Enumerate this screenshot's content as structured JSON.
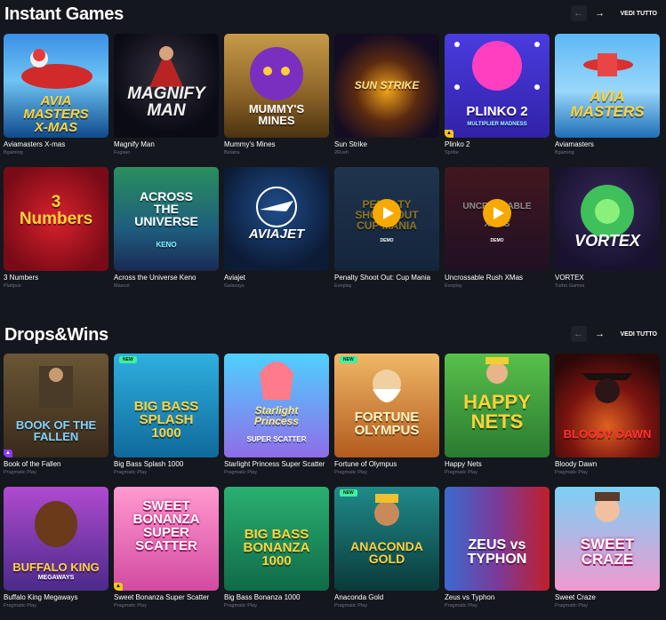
{
  "sections": [
    {
      "title": "Instant Games",
      "see_all": "VEDI TUTTO",
      "games": [
        {
          "name": "Aviamasters X-mas",
          "provider": "Bgaming",
          "art": "AVIA\nMASTERS\nX-MAS"
        },
        {
          "name": "Magnify Man",
          "provider": "Fugaso",
          "art": "MAGNIFY\nMAN"
        },
        {
          "name": "Mummy's Mines",
          "provider": "Belatra",
          "art": "MUMMY'S\nMINES"
        },
        {
          "name": "Sun Strike",
          "provider": "2Rush",
          "art": "SUN STRIKE"
        },
        {
          "name": "Plinko 2",
          "provider": "Spribe",
          "art": "PLINKO 2",
          "art_sub": "MULTIPLIER MADNESS"
        },
        {
          "name": "Aviamasters",
          "provider": "Bgaming",
          "art": "AVIA\nMASTERS"
        },
        {
          "name": "3 Numbers",
          "provider": "Platipus",
          "art": "3\nNumbers"
        },
        {
          "name": "Across the Universe Keno",
          "provider": "Mascot",
          "art": "ACROSS\nTHE\nUNIVERSE",
          "art_sub": "KENO"
        },
        {
          "name": "Aviajet",
          "provider": "Galaxsys",
          "art": "AVIAJET"
        },
        {
          "name": "Penalty Shoot Out: Cup Mania",
          "provider": "Evoplay",
          "art": "PENALTY\nSHOOT OUT\nCUP MANIA",
          "demo": "DEMO"
        },
        {
          "name": "Uncrossable Rush XMas",
          "provider": "Evoplay",
          "art": "UNCROSSABLE\nRUSH\nXMAS",
          "demo": "DEMO"
        },
        {
          "name": "VORTEX",
          "provider": "Turbo Games",
          "art": "VORTEX"
        }
      ]
    },
    {
      "title": "Drops&Wins",
      "see_all": "VEDI TUTTO",
      "games": [
        {
          "name": "Book of the Fallen",
          "provider": "Pragmatic Play",
          "art": "BOOK OF THE\nFALLEN"
        },
        {
          "name": "Big Bass Splash 1000",
          "provider": "Pragmatic Play",
          "art": "BIG BASS\nSPLASH\n1000",
          "badge": "NEW"
        },
        {
          "name": "Starlight Princess Super Scatter",
          "provider": "Pragmatic Play",
          "art": "Starlight\nPrincess",
          "art_sub": "SUPER SCATTER"
        },
        {
          "name": "Fortune of Olympus",
          "provider": "Pragmatic Play",
          "art": "FORTUNE\nOLYMPUS",
          "badge": "NEW"
        },
        {
          "name": "Happy Nets",
          "provider": "Pragmatic Play",
          "art": "HAPPY\nNETS"
        },
        {
          "name": "Bloody Dawn",
          "provider": "Pragmatic Play",
          "art": "BLOODY DAWN"
        },
        {
          "name": "Buffalo King Megaways",
          "provider": "Pragmatic Play",
          "art": "BUFFALO KING",
          "art_sub": "MEGAWAYS"
        },
        {
          "name": "Sweet Bonanza Super Scatter",
          "provider": "Pragmatic Play",
          "art": "SWEET\nBONANZA\nSUPER\nSCATTER"
        },
        {
          "name": "Big Bass Bonanza 1000",
          "provider": "Pragmatic Play",
          "art": "BIG BASS\nBONANZA\n1000"
        },
        {
          "name": "Anaconda Gold",
          "provider": "Pragmatic Play",
          "art": "ANACONDA\nGOLD",
          "badge": "NEW"
        },
        {
          "name": "Zeus vs Typhon",
          "provider": "Pragmatic Play",
          "art": "ZEUS vs\nTYPHON"
        },
        {
          "name": "Sweet Craze",
          "provider": "Pragmatic Play",
          "art": "SWEET\nCRAZE"
        }
      ]
    }
  ]
}
